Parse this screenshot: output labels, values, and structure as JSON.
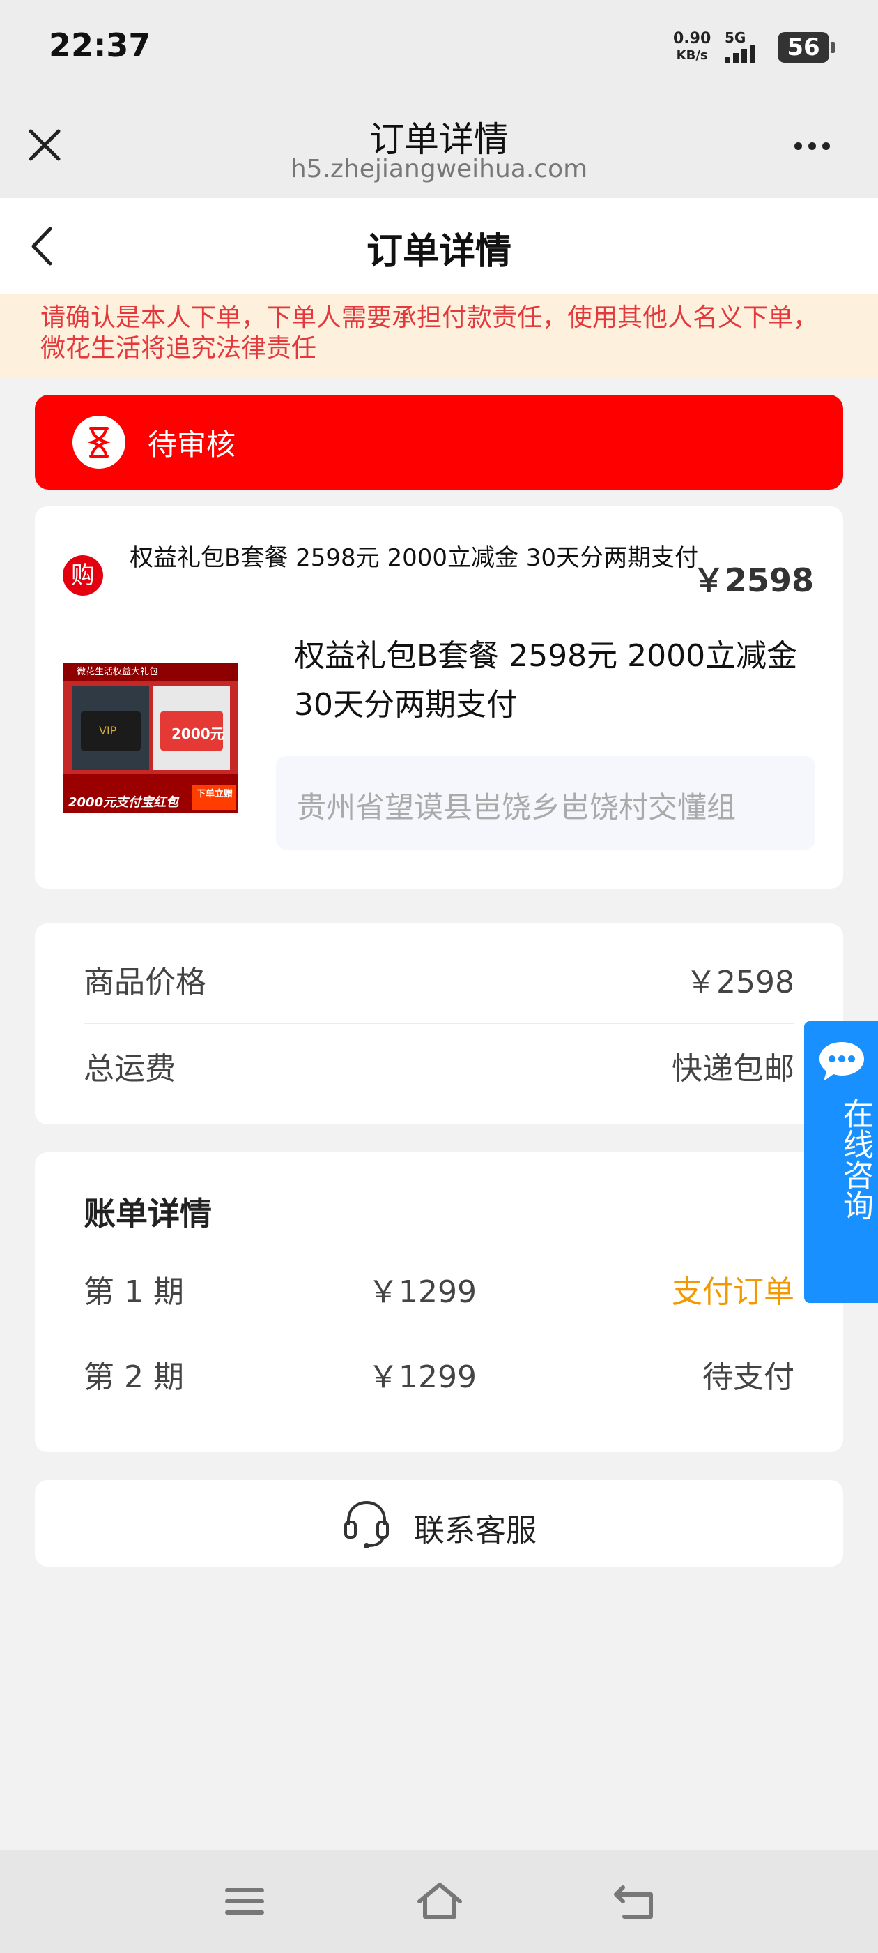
{
  "status_bar": {
    "time": "22:37",
    "net_speed_value": "0.90",
    "net_speed_unit": "KB/s",
    "network": "5G",
    "battery": "56"
  },
  "browser": {
    "title": "订单详情",
    "url": "h5.zhejiangweihua.com",
    "close_icon": "close-icon",
    "more_icon": "more-icon"
  },
  "page": {
    "title": "订单详情",
    "back_icon": "chevron-left-icon"
  },
  "warning": "请确认是本人下单，下单人需要承担付款责任，使用其他人名义下单，微花生活将追究法律责任",
  "order_status": {
    "label": "待审核",
    "icon": "hourglass-icon",
    "color": "#fe0000"
  },
  "product": {
    "badge": "购",
    "header_title": "权益礼包B套餐 2598元 2000立减金 30天分两期支付",
    "header_price": "￥2598",
    "name": "权益礼包B套餐 2598元 2000立减金 30天分两期支付",
    "address": "贵州省望谟县岜饶乡岜饶村交懂组",
    "image": {
      "banner_text": "微花生活权益大礼包",
      "vip_text": "VIP",
      "amount_text": "2000元",
      "bottom_text": "2000元支付宝红包",
      "cta_text": "下单立赠"
    }
  },
  "pricing": {
    "goods_price_label": "商品价格",
    "goods_price_value": "￥2598",
    "shipping_label": "总运费",
    "shipping_value": "快递包邮"
  },
  "bill": {
    "title": "账单详情",
    "installments": [
      {
        "label": "第 1 期",
        "amount": "￥1299",
        "action": "支付订单",
        "color": "#f39800"
      },
      {
        "label": "第 2 期",
        "amount": "￥1299",
        "action": "待支付",
        "color": "#444444"
      }
    ]
  },
  "contact": {
    "label": "联系客服",
    "icon": "headset-icon"
  },
  "consult": {
    "label": "在线咨询",
    "icon": "chat-bubble-icon",
    "color": "#1890ff"
  },
  "navbar": {
    "icons": [
      "menu-icon",
      "home-icon",
      "back-icon"
    ]
  }
}
